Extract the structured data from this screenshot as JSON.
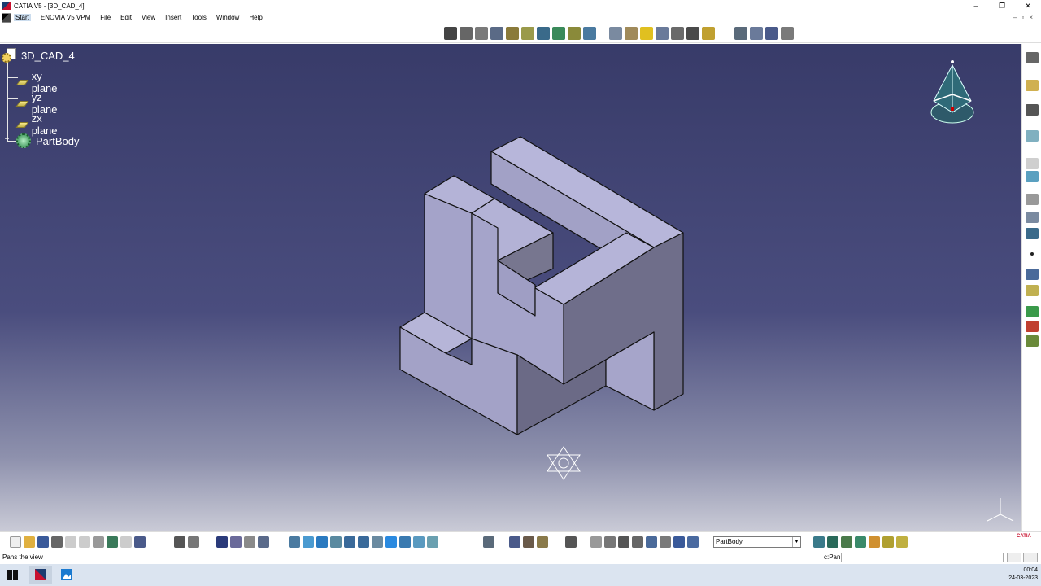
{
  "window": {
    "title": "CATIA V5 - [3D_CAD_4]",
    "controls": [
      "–",
      "❐",
      "✕"
    ]
  },
  "menubar": {
    "items": [
      "Start",
      "ENOVIA V5 VPM",
      "File",
      "Edit",
      "View",
      "Insert",
      "Tools",
      "Window",
      "Help"
    ],
    "sub_controls": "–▫×"
  },
  "tree": {
    "root": "3D_CAD_4",
    "children": [
      "xy plane",
      "yz plane",
      "zx plane",
      "PartBody"
    ]
  },
  "bottom_toolbar": {
    "workbench_value": "PartBody",
    "catia_label": "CATIA"
  },
  "statusbar": {
    "message": "Pans the view",
    "command_label": "c:Pan",
    "command_value": ""
  },
  "taskbar": {
    "time": "00:04",
    "date": "24-03-2023"
  },
  "colors": {
    "viewport_top": "#383b69",
    "viewport_bottom": "#c9cad6",
    "part_light": "#b4b3d6",
    "part_mid": "#a3a2c8",
    "part_dark": "#6e6d88",
    "tree_text": "#ffffff"
  },
  "icons": {
    "tree_root": "part-document-icon",
    "planes": "plane-icon",
    "body": "partbody-gear-icon",
    "compass": "compass-icon",
    "axis": "axis-triad-icon"
  }
}
